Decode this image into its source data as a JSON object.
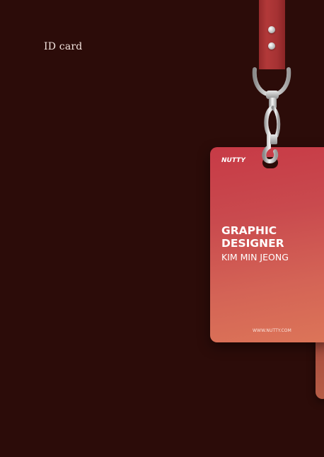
{
  "page": {
    "title": "ID card"
  },
  "card": {
    "brand": "NUTTY",
    "role_line1": "GRAPHIC",
    "role_line2": "DESIGNER",
    "name": "KIM MIN JEONG",
    "website": "WWW.NUTTY.COM"
  },
  "colors": {
    "background": "#2c0c09",
    "strap": "#a53233",
    "card_top": "#c73a46",
    "card_bottom": "#dc7558",
    "text": "#ffffff"
  },
  "icons": {
    "clip": "metal-lanyard-clip-icon"
  }
}
